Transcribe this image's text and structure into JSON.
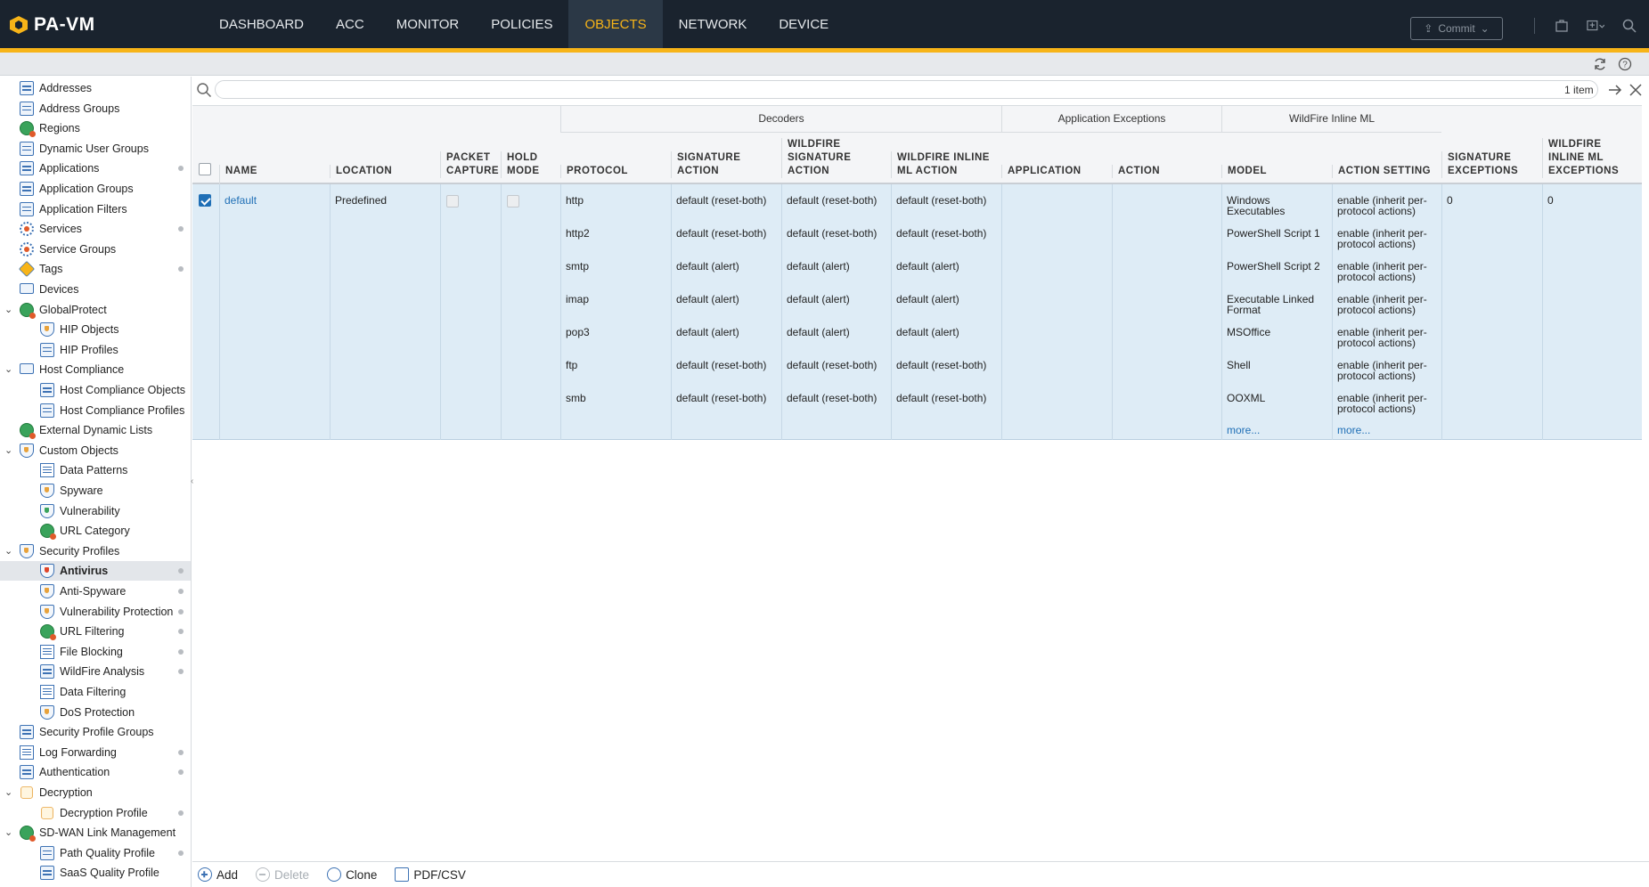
{
  "app": {
    "logo_text": "PA-VM"
  },
  "main_nav": [
    "DASHBOARD",
    "ACC",
    "MONITOR",
    "POLICIES",
    "OBJECTS",
    "NETWORK",
    "DEVICE"
  ],
  "main_nav_active": "OBJECTS",
  "commit_label": "Commit",
  "colors": {
    "accent": "#f7b418",
    "topbar": "#1a232e",
    "link": "#1f6fb6",
    "selected_row": "#deecf6"
  },
  "sidebar": [
    {
      "label": "Addresses",
      "indent": 0,
      "icon": "address-icon",
      "dot": false
    },
    {
      "label": "Address Groups",
      "indent": 0,
      "icon": "address-group-icon",
      "dot": false
    },
    {
      "label": "Regions",
      "indent": 0,
      "icon": "globe-icon",
      "dot": false
    },
    {
      "label": "Dynamic User Groups",
      "indent": 0,
      "icon": "user-group-icon",
      "dot": false
    },
    {
      "label": "Applications",
      "indent": 0,
      "icon": "applications-icon",
      "dot": true
    },
    {
      "label": "Application Groups",
      "indent": 0,
      "icon": "application-group-icon",
      "dot": false
    },
    {
      "label": "Application Filters",
      "indent": 0,
      "icon": "application-filter-icon",
      "dot": false
    },
    {
      "label": "Services",
      "indent": 0,
      "icon": "services-icon",
      "dot": true
    },
    {
      "label": "Service Groups",
      "indent": 0,
      "icon": "service-group-icon",
      "dot": false
    },
    {
      "label": "Tags",
      "indent": 0,
      "icon": "tag-icon",
      "dot": true
    },
    {
      "label": "Devices",
      "indent": 0,
      "icon": "device-icon",
      "dot": false
    },
    {
      "label": "GlobalProtect",
      "indent": 0,
      "icon": "globalprotect-icon",
      "dot": false,
      "expanded": true
    },
    {
      "label": "HIP Objects",
      "indent": 1,
      "icon": "hip-objects-icon",
      "dot": false
    },
    {
      "label": "HIP Profiles",
      "indent": 1,
      "icon": "hip-profiles-icon",
      "dot": false
    },
    {
      "label": "Host Compliance",
      "indent": 0,
      "icon": "host-compliance-icon",
      "dot": false,
      "expanded": true
    },
    {
      "label": "Host Compliance Objects",
      "indent": 1,
      "icon": "host-compliance-objects-icon",
      "dot": false
    },
    {
      "label": "Host Compliance Profiles",
      "indent": 1,
      "icon": "host-compliance-profiles-icon",
      "dot": false
    },
    {
      "label": "External Dynamic Lists",
      "indent": 0,
      "icon": "external-dynamic-list-icon",
      "dot": false
    },
    {
      "label": "Custom Objects",
      "indent": 0,
      "icon": "custom-objects-icon",
      "dot": false,
      "expanded": true
    },
    {
      "label": "Data Patterns",
      "indent": 1,
      "icon": "data-patterns-icon",
      "dot": false
    },
    {
      "label": "Spyware",
      "indent": 1,
      "icon": "spyware-icon",
      "dot": false
    },
    {
      "label": "Vulnerability",
      "indent": 1,
      "icon": "vulnerability-icon",
      "dot": false
    },
    {
      "label": "URL Category",
      "indent": 1,
      "icon": "url-category-icon",
      "dot": false
    },
    {
      "label": "Security Profiles",
      "indent": 0,
      "icon": "security-profiles-icon",
      "dot": false,
      "expanded": true
    },
    {
      "label": "Antivirus",
      "indent": 1,
      "icon": "antivirus-icon",
      "dot": true,
      "selected": true
    },
    {
      "label": "Anti-Spyware",
      "indent": 1,
      "icon": "anti-spyware-icon",
      "dot": true
    },
    {
      "label": "Vulnerability Protection",
      "indent": 1,
      "icon": "vulnerability-protection-icon",
      "dot": true
    },
    {
      "label": "URL Filtering",
      "indent": 1,
      "icon": "url-filtering-icon",
      "dot": true
    },
    {
      "label": "File Blocking",
      "indent": 1,
      "icon": "file-blocking-icon",
      "dot": true
    },
    {
      "label": "WildFire Analysis",
      "indent": 1,
      "icon": "wildfire-analysis-icon",
      "dot": true
    },
    {
      "label": "Data Filtering",
      "indent": 1,
      "icon": "data-filtering-icon",
      "dot": false
    },
    {
      "label": "DoS Protection",
      "indent": 1,
      "icon": "dos-protection-icon",
      "dot": false
    },
    {
      "label": "Security Profile Groups",
      "indent": 0,
      "icon": "security-profile-groups-icon",
      "dot": false
    },
    {
      "label": "Log Forwarding",
      "indent": 0,
      "icon": "log-forwarding-icon",
      "dot": true
    },
    {
      "label": "Authentication",
      "indent": 0,
      "icon": "authentication-icon",
      "dot": true
    },
    {
      "label": "Decryption",
      "indent": 0,
      "icon": "decryption-icon",
      "dot": false,
      "expanded": true
    },
    {
      "label": "Decryption Profile",
      "indent": 1,
      "icon": "decryption-profile-icon",
      "dot": true
    },
    {
      "label": "SD-WAN Link Management",
      "indent": 0,
      "icon": "sdwan-icon",
      "dot": false,
      "expanded": true
    },
    {
      "label": "Path Quality Profile",
      "indent": 1,
      "icon": "path-quality-icon",
      "dot": true
    },
    {
      "label": "SaaS Quality Profile",
      "indent": 1,
      "icon": "saas-quality-icon",
      "dot": false
    }
  ],
  "search": {
    "placeholder": "",
    "value": "",
    "count": "1 item"
  },
  "table": {
    "groups": {
      "decoders": "Decoders",
      "app_exceptions": "Application Exceptions",
      "wildfire_ml": "WildFire Inline ML"
    },
    "headers": {
      "name": "NAME",
      "location": "LOCATION",
      "packet_capture": "PACKET CAPTURE",
      "hold_mode": "HOLD MODE",
      "protocol": "PROTOCOL",
      "signature_action": "SIGNATURE ACTION",
      "wildfire_signature_action": "WILDFIRE SIGNATURE ACTION",
      "wildfire_inline_ml_action": "WILDFIRE INLINE ML ACTION",
      "application": "APPLICATION",
      "action": "ACTION",
      "model": "MODEL",
      "action_setting": "ACTION SETTING",
      "signature_exceptions": "SIGNATURE EXCEPTIONS",
      "wildfire_inline_ml_exceptions": "WILDFIRE INLINE ML EXCEPTIONS"
    },
    "row": {
      "name": "default",
      "location": "Predefined",
      "signature_exceptions": "0",
      "wildfire_inline_ml_exceptions": "0",
      "decoders": [
        {
          "protocol": "http",
          "signature_action": "default (reset-both)",
          "wildfire_signature_action": "default (reset-both)",
          "wildfire_inline_ml_action": "default (reset-both)"
        },
        {
          "protocol": "http2",
          "signature_action": "default (reset-both)",
          "wildfire_signature_action": "default (reset-both)",
          "wildfire_inline_ml_action": "default (reset-both)"
        },
        {
          "protocol": "smtp",
          "signature_action": "default (alert)",
          "wildfire_signature_action": "default (alert)",
          "wildfire_inline_ml_action": "default (alert)"
        },
        {
          "protocol": "imap",
          "signature_action": "default (alert)",
          "wildfire_signature_action": "default (alert)",
          "wildfire_inline_ml_action": "default (alert)"
        },
        {
          "protocol": "pop3",
          "signature_action": "default (alert)",
          "wildfire_signature_action": "default (alert)",
          "wildfire_inline_ml_action": "default (alert)"
        },
        {
          "protocol": "ftp",
          "signature_action": "default (reset-both)",
          "wildfire_signature_action": "default (reset-both)",
          "wildfire_inline_ml_action": "default (reset-both)"
        },
        {
          "protocol": "smb",
          "signature_action": "default (reset-both)",
          "wildfire_signature_action": "default (reset-both)",
          "wildfire_inline_ml_action": "default (reset-both)"
        }
      ],
      "ml_models": [
        {
          "model": "Windows Executables",
          "action_setting": "enable (inherit per-protocol actions)"
        },
        {
          "model": "PowerShell Script 1",
          "action_setting": "enable (inherit per-protocol actions)"
        },
        {
          "model": "PowerShell Script 2",
          "action_setting": "enable (inherit per-protocol actions)"
        },
        {
          "model": "Executable Linked Format",
          "action_setting": "enable (inherit per-protocol actions)"
        },
        {
          "model": "MSOffice",
          "action_setting": "enable (inherit per-protocol actions)"
        },
        {
          "model": "Shell",
          "action_setting": "enable (inherit per-protocol actions)"
        },
        {
          "model": "OOXML",
          "action_setting": "enable (inherit per-protocol actions)"
        }
      ],
      "more_label": "more..."
    }
  },
  "bottom_toolbar": {
    "add": "Add",
    "delete": "Delete",
    "clone": "Clone",
    "pdf_csv": "PDF/CSV"
  }
}
